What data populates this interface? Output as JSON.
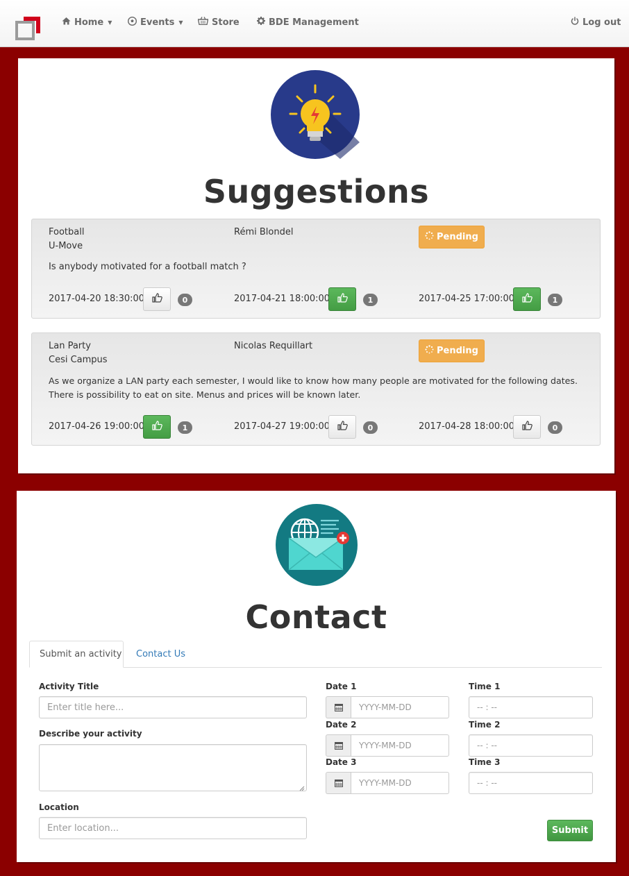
{
  "navbar": {
    "items": [
      {
        "label": "Home",
        "icon": "home-icon"
      },
      {
        "label": "Events",
        "icon": "soccer-ball-icon"
      },
      {
        "label": "Store",
        "icon": "basket-icon"
      },
      {
        "label": "BDE Management",
        "icon": "gear-icon"
      }
    ],
    "logout": {
      "label": "Log out",
      "icon": "power-icon"
    },
    "brand_color": "#d0021b"
  },
  "suggestions": {
    "title": "Suggestions",
    "cards": [
      {
        "title": "Football",
        "location": "U-Move",
        "author": "Rémi Blondel",
        "status": "Pending",
        "description": [
          "Is anybody motivated for a football match ?"
        ],
        "dates": [
          {
            "date": "2017-04-20 18:30:00",
            "count": "0",
            "voted": false
          },
          {
            "date": "2017-04-21 18:00:00",
            "count": "1",
            "voted": true
          },
          {
            "date": "2017-04-25 17:00:00",
            "count": "1",
            "voted": true
          }
        ]
      },
      {
        "title": "Lan Party",
        "location": "Cesi Campus",
        "author": "Nicolas Requillart",
        "status": "Pending",
        "description": [
          "As we organize a LAN party each semester, I would like to know how many people are motivated for the following dates.",
          "There is possibility to eat on site. Menus and prices will be known later."
        ],
        "dates": [
          {
            "date": "2017-04-26 19:00:00",
            "count": "1",
            "voted": true
          },
          {
            "date": "2017-04-27 19:00:00",
            "count": "0",
            "voted": false
          },
          {
            "date": "2017-04-28 18:00:00",
            "count": "0",
            "voted": false
          }
        ]
      }
    ]
  },
  "contact": {
    "title": "Contact",
    "tabs": [
      {
        "label": "Submit an activity",
        "active": true
      },
      {
        "label": "Contact Us",
        "active": false
      }
    ],
    "form": {
      "activity_title_label": "Activity Title",
      "activity_title_placeholder": "Enter title here...",
      "description_label": "Describe your activity",
      "location_label": "Location",
      "location_placeholder": "Enter location...",
      "dates": [
        {
          "label": "Date 1",
          "placeholder": "YYYY-MM-DD",
          "time_label": "Time 1",
          "time_placeholder": "-- : --"
        },
        {
          "label": "Date 2",
          "placeholder": "YYYY-MM-DD",
          "time_label": "Time 2",
          "time_placeholder": "-- : --"
        },
        {
          "label": "Date 3",
          "placeholder": "YYYY-MM-DD",
          "time_label": "Time 3",
          "time_placeholder": "-- : --"
        }
      ],
      "submit_label": "Submit"
    }
  },
  "colors": {
    "page_bg": "#8b0000",
    "pending": "#f0ad4e",
    "success": "#5cb85c",
    "link": "#337ab7"
  }
}
